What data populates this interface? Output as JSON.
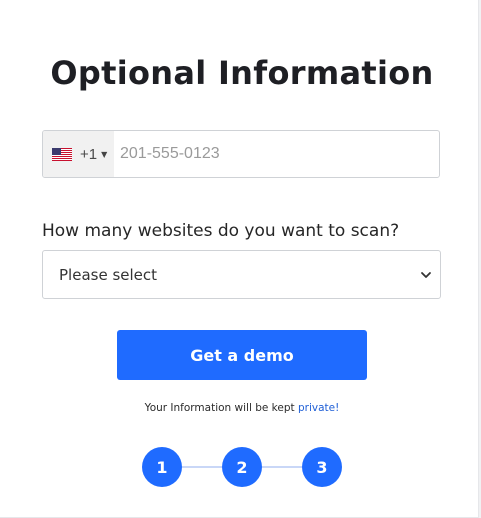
{
  "form": {
    "title": "Optional Information",
    "phone": {
      "country_icon": "us-flag-icon",
      "dial_code": "+1",
      "placeholder": "201-555-0123",
      "value": ""
    },
    "websites_question": "How many websites do you want to scan?",
    "websites_select": {
      "selected": "Please select"
    },
    "submit_label": "Get a demo",
    "privacy_text": "Your Information will be kept",
    "privacy_link": "private!",
    "steps": [
      "1",
      "2",
      "3"
    ]
  },
  "colors": {
    "accent": "#1f6bff",
    "title": "#1e1f24",
    "link": "#1f5fd6",
    "step_line": "#c9d7f7"
  }
}
